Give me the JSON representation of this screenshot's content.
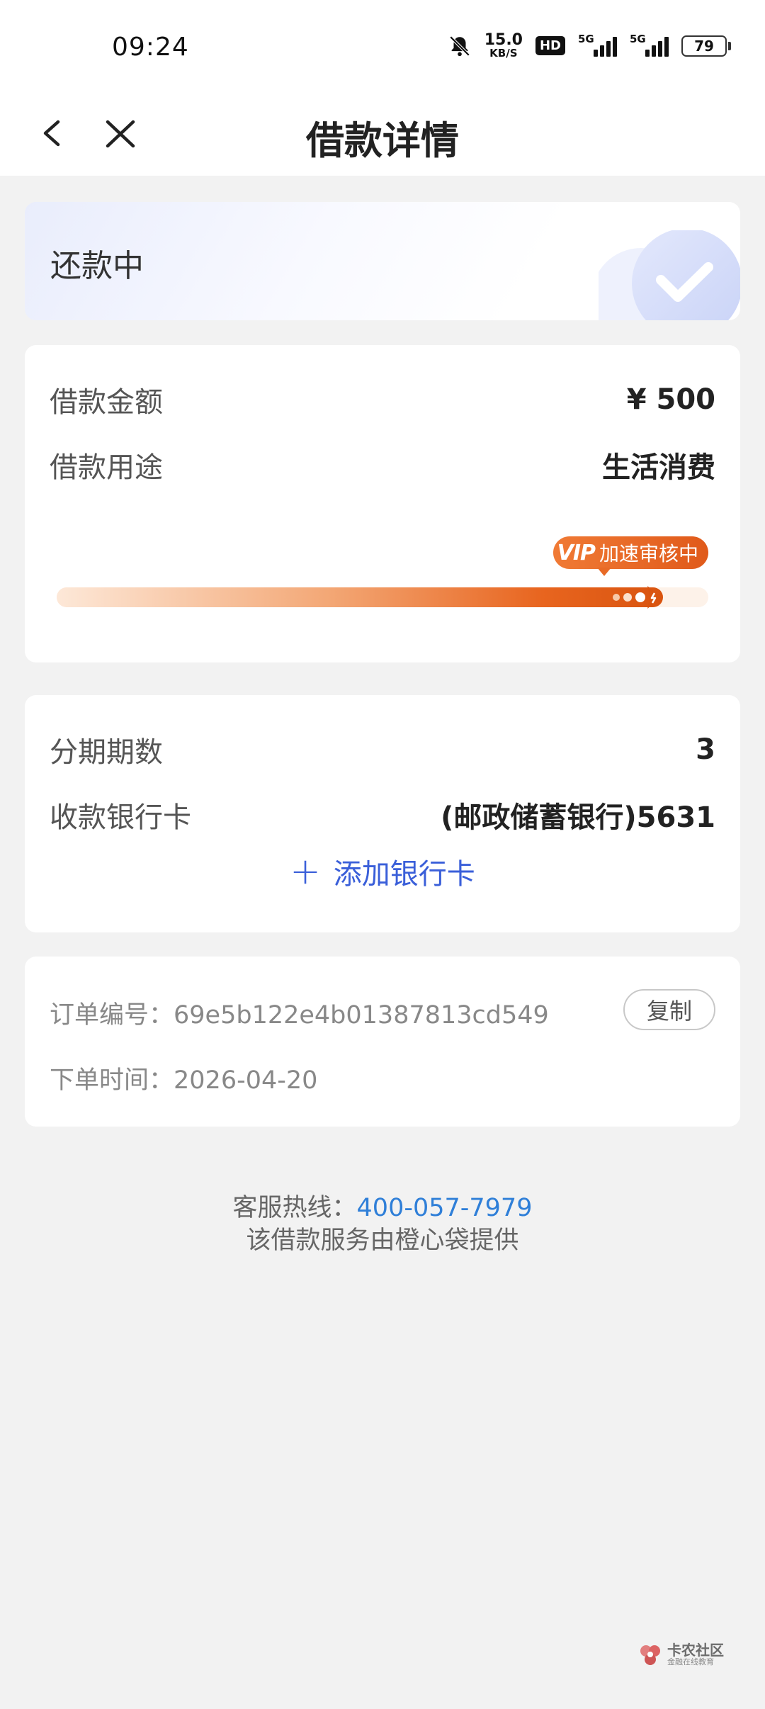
{
  "status_bar": {
    "time": "09:24",
    "net_speed_value": "15.0",
    "net_speed_unit": "KB/S",
    "hd_label": "HD",
    "sim1_label": "5G",
    "sim2_label": "5G",
    "battery": "79"
  },
  "nav": {
    "title": "借款详情"
  },
  "status_card": {
    "text": "还款中"
  },
  "loan": {
    "amount_label": "借款金额",
    "amount_value": "¥ 500",
    "purpose_label": "借款用途",
    "purpose_value": "生活消费",
    "vip_text": "VIP",
    "review_text": "加速审核中",
    "progress": 0.93
  },
  "installment": {
    "periods_label": "分期期数",
    "periods_value": "3",
    "bank_label": "收款银行卡",
    "bank_value": "(邮政储蓄银行)5631",
    "add_card_plus": "+",
    "add_card_label": "添加银行卡"
  },
  "order": {
    "number_label": "订单编号：",
    "number_value": "69e5b122e4b01387813cd549",
    "copy_label": "复制",
    "time_label": "下单时间：",
    "time_value": "2026-04-20"
  },
  "footer": {
    "hotline_label": "客服热线：",
    "hotline_number": "400-057-7979",
    "provider_text": "该借款服务由橙心袋提供"
  },
  "watermark": {
    "title": "卡农社区",
    "subtitle": "金融在线教育"
  },
  "colors": {
    "accent_blue": "#3a5fd9",
    "phone_blue": "#2f7fd8",
    "progress_orange": "#e8651f"
  }
}
